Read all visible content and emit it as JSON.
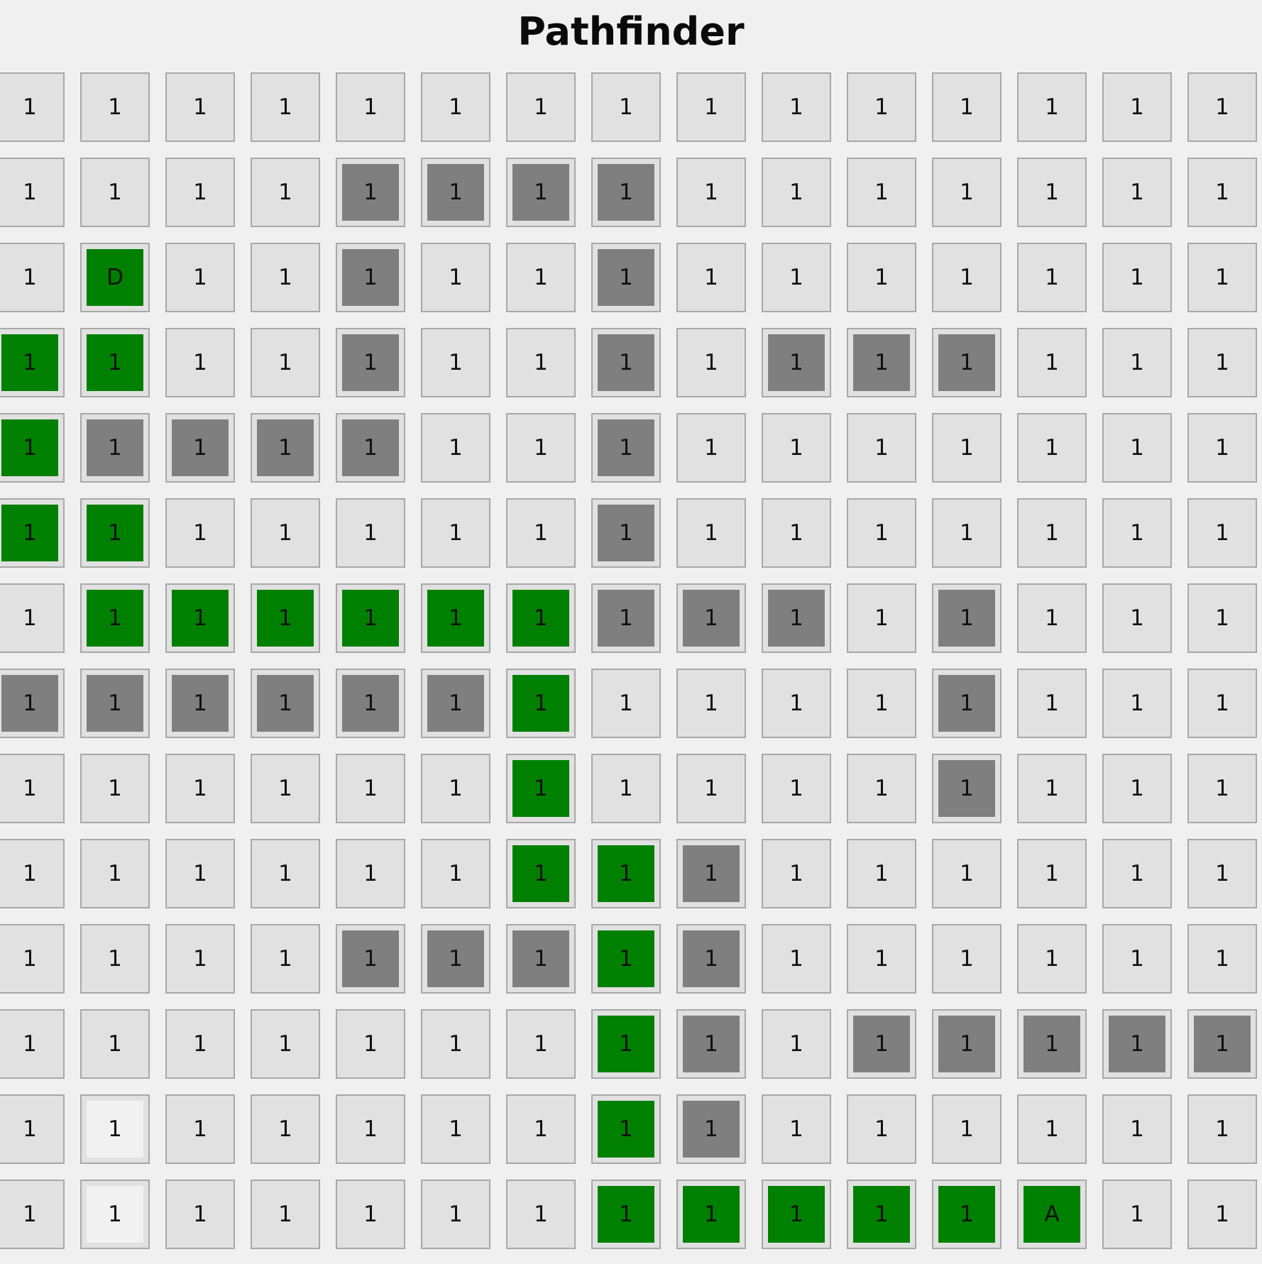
{
  "title": "Pathfinder",
  "colors": {
    "background": "#f0f0f0",
    "cell": "#e1e1e1",
    "cell_border": "#a8a8a8",
    "wall": "#7f7f7f",
    "path": "#008000",
    "highlight": "#f1f1f1"
  },
  "legend": {
    ".": "open",
    "#": "wall",
    "P": "path",
    "L": "highlighted"
  },
  "grid": {
    "rows": 14,
    "cols": 15,
    "labels": [
      [
        "1",
        "1",
        "1",
        "1",
        "1",
        "1",
        "1",
        "1",
        "1",
        "1",
        "1",
        "1",
        "1",
        "1",
        "1"
      ],
      [
        "1",
        "1",
        "1",
        "1",
        "1",
        "1",
        "1",
        "1",
        "1",
        "1",
        "1",
        "1",
        "1",
        "1",
        "1"
      ],
      [
        "1",
        "D",
        "1",
        "1",
        "1",
        "1",
        "1",
        "1",
        "1",
        "1",
        "1",
        "1",
        "1",
        "1",
        "1"
      ],
      [
        "1",
        "1",
        "1",
        "1",
        "1",
        "1",
        "1",
        "1",
        "1",
        "1",
        "1",
        "1",
        "1",
        "1",
        "1"
      ],
      [
        "1",
        "1",
        "1",
        "1",
        "1",
        "1",
        "1",
        "1",
        "1",
        "1",
        "1",
        "1",
        "1",
        "1",
        "1"
      ],
      [
        "1",
        "1",
        "1",
        "1",
        "1",
        "1",
        "1",
        "1",
        "1",
        "1",
        "1",
        "1",
        "1",
        "1",
        "1"
      ],
      [
        "1",
        "1",
        "1",
        "1",
        "1",
        "1",
        "1",
        "1",
        "1",
        "1",
        "1",
        "1",
        "1",
        "1",
        "1"
      ],
      [
        "1",
        "1",
        "1",
        "1",
        "1",
        "1",
        "1",
        "1",
        "1",
        "1",
        "1",
        "1",
        "1",
        "1",
        "1"
      ],
      [
        "1",
        "1",
        "1",
        "1",
        "1",
        "1",
        "1",
        "1",
        "1",
        "1",
        "1",
        "1",
        "1",
        "1",
        "1"
      ],
      [
        "1",
        "1",
        "1",
        "1",
        "1",
        "1",
        "1",
        "1",
        "1",
        "1",
        "1",
        "1",
        "1",
        "1",
        "1"
      ],
      [
        "1",
        "1",
        "1",
        "1",
        "1",
        "1",
        "1",
        "1",
        "1",
        "1",
        "1",
        "1",
        "1",
        "1",
        "1"
      ],
      [
        "1",
        "1",
        "1",
        "1",
        "1",
        "1",
        "1",
        "1",
        "1",
        "1",
        "1",
        "1",
        "1",
        "1",
        "1"
      ],
      [
        "1",
        "1",
        "1",
        "1",
        "1",
        "1",
        "1",
        "1",
        "1",
        "1",
        "1",
        "1",
        "1",
        "1",
        "1"
      ],
      [
        "1",
        "1",
        "1",
        "1",
        "1",
        "1",
        "1",
        "1",
        "1",
        "1",
        "1",
        "1",
        "A",
        "1",
        "1"
      ]
    ],
    "states": [
      "...............",
      "....####.......",
      ".P..#..#.......",
      "PP..#..#.###...",
      "P####..#.......",
      "PP.....#.......",
      ".PPPPPP###.#...",
      "######P....#...",
      "......P....#...",
      "......PP#......",
      "....###P#......",
      ".......P#.#####",
      ".L.....P#......",
      ".L.....PPPPPP.."
    ]
  }
}
